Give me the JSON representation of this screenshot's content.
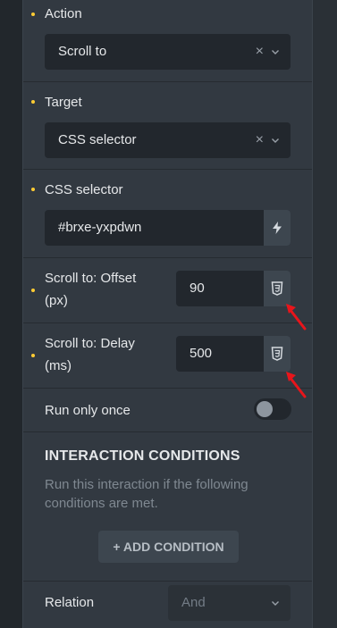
{
  "action": {
    "label": "Action",
    "value": "Scroll to",
    "clear_glyph": "×"
  },
  "target": {
    "label": "Target",
    "value": "CSS selector",
    "clear_glyph": "×"
  },
  "css_selector": {
    "label": "CSS selector",
    "value": "#brxe-yxpdwn",
    "button_icon": "lightning-icon"
  },
  "offset": {
    "label_line1": "Scroll to: Offset",
    "label_line2": "(px)",
    "value": "90",
    "button_icon": "css3-icon"
  },
  "delay": {
    "label_line1": "Scroll to: Delay",
    "label_line2": "(ms)",
    "value": "500",
    "button_icon": "css3-icon"
  },
  "run_only_once": {
    "label": "Run only once",
    "enabled": false
  },
  "conditions": {
    "heading": "INTERACTION CONDITIONS",
    "description": "Run this interaction if the following conditions are met.",
    "add_button_label": "+ ADD CONDITION"
  },
  "relation": {
    "label": "Relation",
    "value": "And"
  },
  "colors": {
    "accent_dot": "#ffcc33",
    "annotation_arrow": "#e8151b"
  }
}
